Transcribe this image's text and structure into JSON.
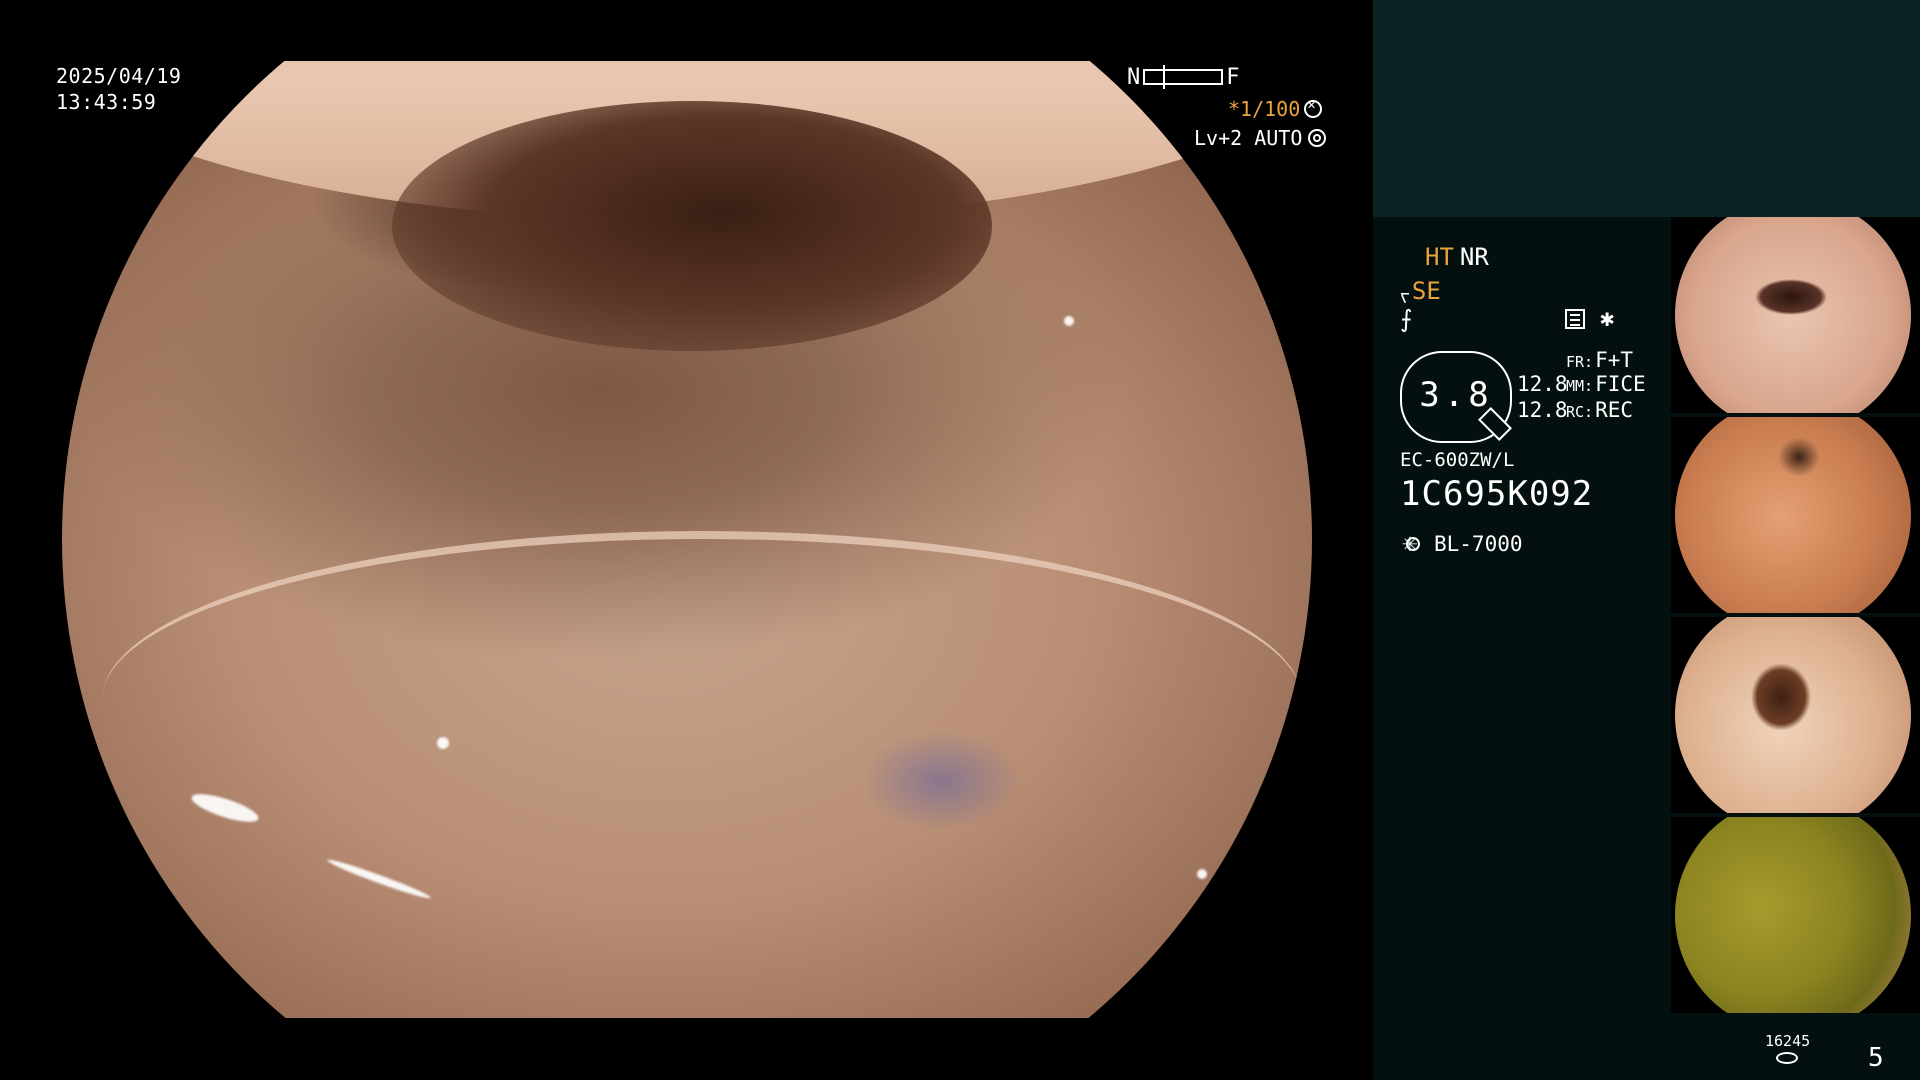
{
  "osd": {
    "date": "2025/04/19",
    "time": "13:43:59",
    "nf_near": "N",
    "nf_far": "F",
    "shutter": "*1/100",
    "level": "Lv+2 AUTO"
  },
  "panel": {
    "ht": "HT",
    "nr": "NR",
    "se": "SE",
    "zoom": "3.8",
    "value_a": "12.8",
    "value_b": "12.8",
    "fr_key": "FR:",
    "fr_val": "F+T",
    "mm_key": "MM:",
    "mm_val": "FICE",
    "rc_key": "RC:",
    "rc_val": "REC",
    "scope_model": "EC-600ZW/L",
    "scope_serial": "1C695K092",
    "light_source": "BL-7000",
    "storage_counter": "16245",
    "page_number": "5"
  },
  "colors": {
    "accent_orange": "#e8a33d",
    "panel_bg": "#04100f",
    "panel_top": "#0b2323"
  },
  "icons": [
    "menu-icon",
    "asterisk-icon",
    "sun-icon",
    "disk-icon",
    "shutter-icon",
    "level-icon"
  ]
}
